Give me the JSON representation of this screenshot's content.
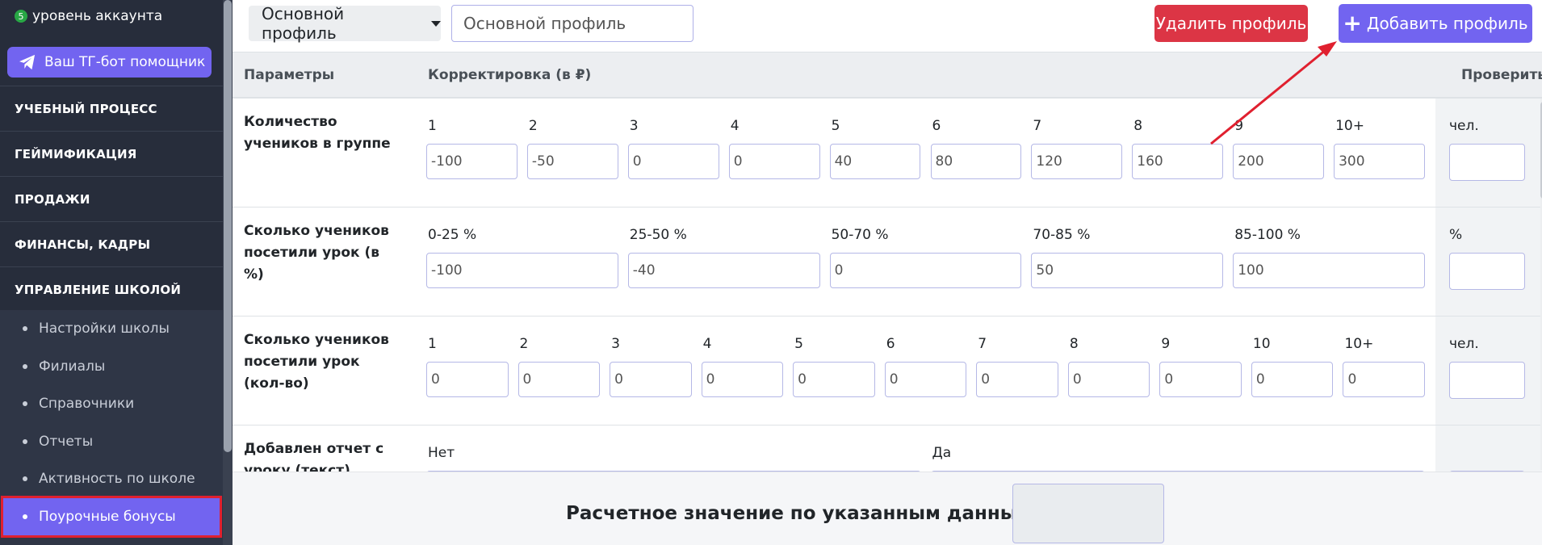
{
  "sidebar": {
    "account_level_badge": "5",
    "account_level": "уровень аккаунта",
    "tg_button": "Ваш ТГ-бот помощник",
    "sections": [
      "УЧЕБНЫЙ ПРОЦЕСС",
      "ГЕЙМИФИКАЦИЯ",
      "ПРОДАЖИ",
      "ФИНАНСЫ, КАДРЫ",
      "УПРАВЛЕНИЕ ШКОЛОЙ"
    ],
    "sub_items": [
      "Настройки школы",
      "Филиалы",
      "Справочники",
      "Отчеты",
      "Активность по школе",
      "Поурочные бонусы"
    ],
    "active_sub_item": "Поурочные бонусы"
  },
  "toolbar": {
    "profile_select": "Основной профиль",
    "profile_name_value": "Основной профиль",
    "delete_label": "Удалить профиль",
    "add_label": "Добавить профиль"
  },
  "table": {
    "headers": {
      "params": "Параметры",
      "correction": "Корректировка (в ₽)",
      "check": "Проверить"
    },
    "rows": [
      {
        "label": "Количество учеников в группе",
        "cols": [
          "1",
          "2",
          "3",
          "4",
          "5",
          "6",
          "7",
          "8",
          "9",
          "10+"
        ],
        "values": [
          "-100",
          "-50",
          "0",
          "0",
          "40",
          "80",
          "120",
          "160",
          "200",
          "300"
        ],
        "check_unit": "чел."
      },
      {
        "label": "Сколько учеников посетили урок (в %)",
        "cols": [
          "0-25 %",
          "25-50 %",
          "50-70 %",
          "70-85 %",
          "85-100 %"
        ],
        "values": [
          "-100",
          "-40",
          "0",
          "50",
          "100"
        ],
        "check_unit": "%"
      },
      {
        "label": "Сколько учеников посетили урок (кол-во)",
        "cols": [
          "1",
          "2",
          "3",
          "4",
          "5",
          "6",
          "7",
          "8",
          "9",
          "10",
          "10+"
        ],
        "values": [
          "0",
          "0",
          "0",
          "0",
          "0",
          "0",
          "0",
          "0",
          "0",
          "0",
          "0"
        ],
        "check_unit": "чел."
      },
      {
        "label": "Добавлен отчет с уроку (текст)",
        "cols": [
          "Нет",
          "Да"
        ],
        "values": [
          "",
          ""
        ],
        "check_unit": ""
      }
    ]
  },
  "footer": {
    "title": "Расчетное значение по указанным данным"
  },
  "colors": {
    "accent": "#7264f0",
    "danger": "#dc3545",
    "sidebar_bg": "#272d3b"
  }
}
